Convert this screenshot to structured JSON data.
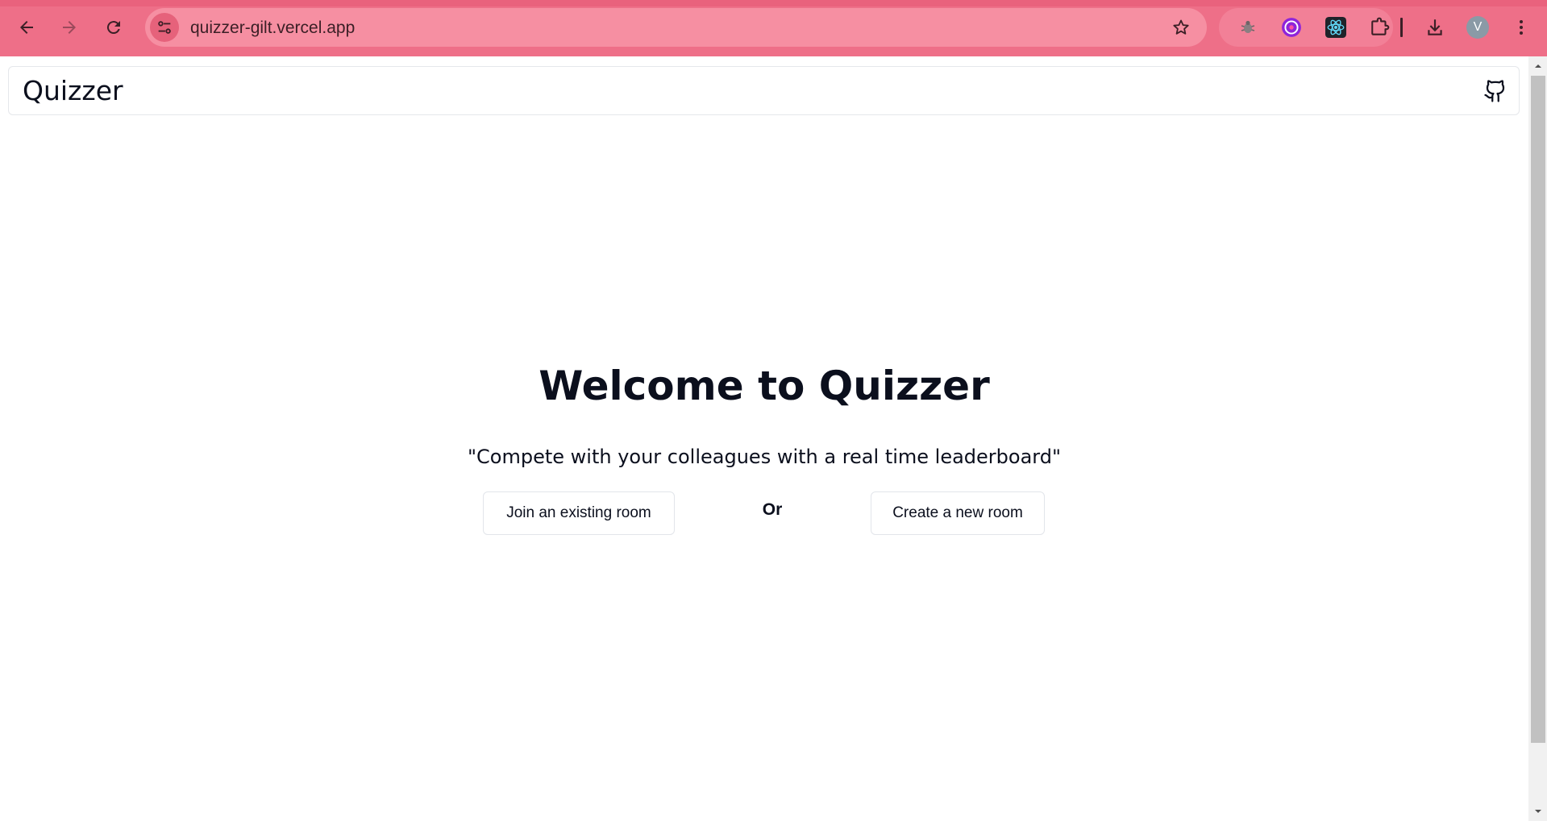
{
  "browser": {
    "url": "quizzer-gilt.vercel.app",
    "profile_initial": "V",
    "icons": {
      "back": "back-arrow-icon",
      "forward": "forward-arrow-icon",
      "reload": "reload-icon",
      "site_info": "tune-icon",
      "bookmark": "star-icon",
      "extensions": [
        "bug-extension-icon",
        "purple-extension-icon",
        "react-devtools-icon",
        "puzzle-extensions-icon"
      ],
      "downloads": "download-icon",
      "menu": "kebab-menu-icon"
    },
    "colors": {
      "chrome": "#ee6f88",
      "omnibox": "#f68fa2"
    }
  },
  "app": {
    "brand": "Quizzer",
    "github_icon": "github-icon"
  },
  "hero": {
    "title": "Welcome to Quizzer",
    "tagline": "\"Compete with your colleagues with a real time leaderboard\"",
    "join_label": "Join an existing room",
    "or_label": "Or",
    "create_label": "Create a new room"
  }
}
